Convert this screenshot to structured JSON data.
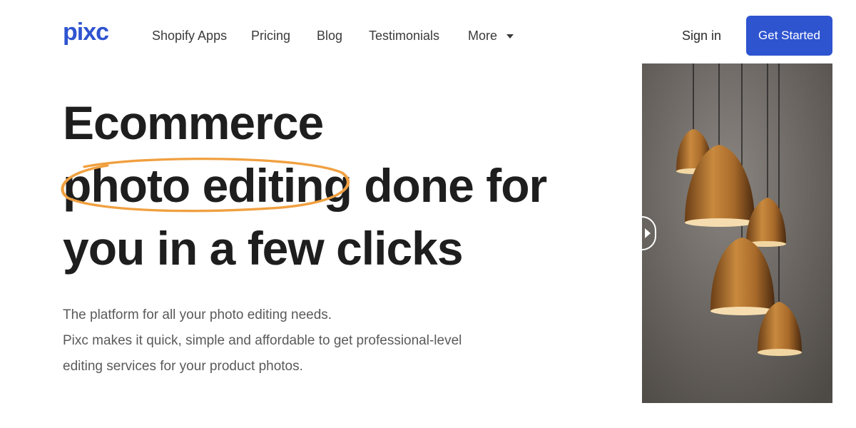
{
  "brand": {
    "name": "pixc",
    "color": "#2f54d0"
  },
  "nav": {
    "items": [
      {
        "label": "Shopify Apps"
      },
      {
        "label": "Pricing"
      },
      {
        "label": "Blog"
      },
      {
        "label": "Testimonials"
      },
      {
        "label": "More"
      }
    ],
    "signin_label": "Sign in",
    "cta_label": "Get Started",
    "cta_color": "#2f54d0"
  },
  "hero": {
    "headline_before": "Ecommerce ",
    "headline_highlight": "photo editing",
    "headline_after": " done for you in a few clicks",
    "highlight_color": "#f0a040",
    "subtext_lines": [
      "The platform for all your photo editing needs.",
      "Pixc makes it quick, simple and affordable to get professional-level",
      "editing services for your product photos."
    ]
  }
}
